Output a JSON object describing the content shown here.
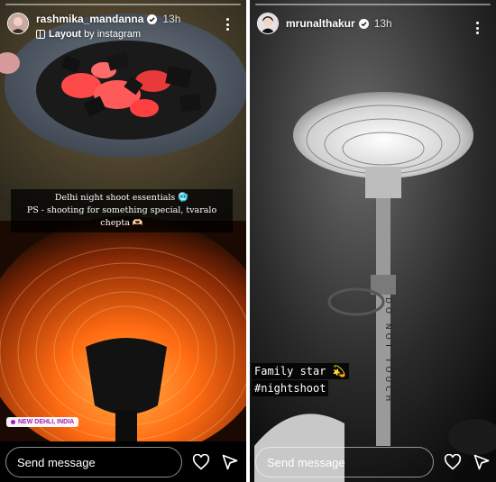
{
  "left_story": {
    "username": "rashmika_mandanna",
    "time_ago": "13h",
    "layout_label": "Layout",
    "layout_source": "by instagram",
    "caption_line1": "Delhi night shoot essentials 🥶",
    "caption_line2": "PS - shooting for something special, tvaralo chepta 🫶🏻",
    "location": "NEW DEHLI, INDIA",
    "send_placeholder": "Send message",
    "icons": {
      "verified": "verified-badge-icon",
      "more": "more-options-icon",
      "layout": "layout-icon",
      "location": "location-pin-icon",
      "heart": "heart-icon",
      "share": "send-icon"
    }
  },
  "right_story": {
    "username": "mrunalthakur",
    "time_ago": "13h",
    "text_line1": "Family star 💫",
    "text_line2": "#nightshoot",
    "heater_writing": "DO NOT TOUCH",
    "send_placeholder": "Send message",
    "icons": {
      "verified": "verified-badge-icon",
      "more": "more-options-icon",
      "heart": "heart-icon",
      "share": "send-icon"
    }
  },
  "colors": {
    "background": "#000000",
    "location_tag": "#a01dbb",
    "heater_glow": "#ff7a1a",
    "coals_glow": "#ff3b3b"
  }
}
